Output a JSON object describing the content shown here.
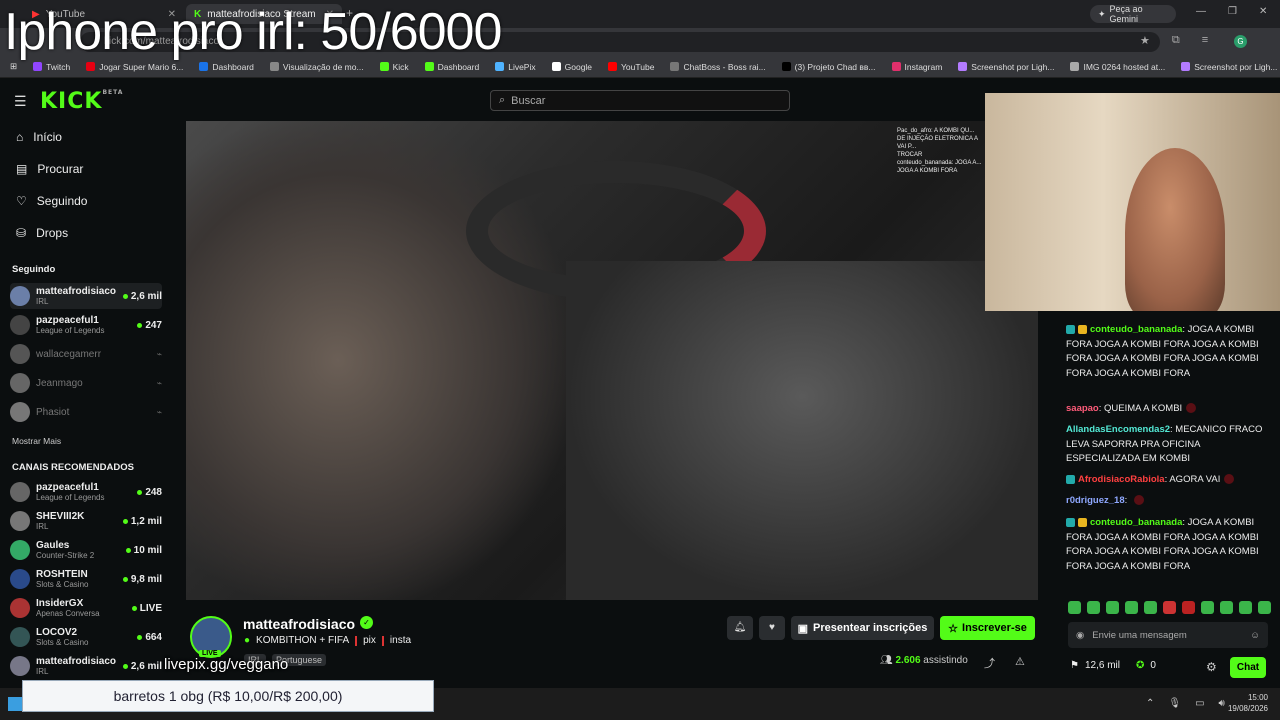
{
  "overlay_title": "Iphone pro irl: 50/6000",
  "browser": {
    "tabs": [
      {
        "label": "YouTube"
      },
      {
        "label": "matteafrodisiaco Stream"
      }
    ],
    "gemini_label": "Peça ao Gemini",
    "url": "kick.com/matteafrodisiaco",
    "bookmarks": [
      "Twitch",
      "Jogar Super Mario 6...",
      "Dashboard",
      "Visualização de mo...",
      "Kick",
      "Dashboard",
      "LivePix",
      "Google",
      "YouTube",
      "ChatBoss - Boss rai...",
      "(3) Projeto Chad вв...",
      "Instagram",
      "Screenshot por Ligh...",
      "IMG 0264 hosted at...",
      "Screenshot por Ligh..."
    ]
  },
  "kick": {
    "logo": "KICK",
    "logo_beta": "BETA",
    "search_placeholder": "Buscar",
    "nav": [
      {
        "label": "Início",
        "icon": "home-icon"
      },
      {
        "label": "Procurar",
        "icon": "browse-icon"
      },
      {
        "label": "Seguindo",
        "icon": "heart-icon"
      },
      {
        "label": "Drops",
        "icon": "drops-icon"
      }
    ],
    "following_header": "Seguindo",
    "following": [
      {
        "name": "matteafrodisiaco",
        "category": "IRL",
        "viewers": "2,6 mil",
        "online": true
      },
      {
        "name": "pazpeaceful1",
        "category": "League of Legends",
        "viewers": "247",
        "online": true
      },
      {
        "name": "wallacegamerr",
        "category": "",
        "viewers": "",
        "online": false
      },
      {
        "name": "Jeanmago",
        "category": "",
        "viewers": "",
        "online": false
      },
      {
        "name": "Phasiot",
        "category": "",
        "viewers": "",
        "online": false
      }
    ],
    "show_more": "Mostrar Mais",
    "recommended_header": "CANAIS RECOMENDADOS",
    "recommended": [
      {
        "name": "pazpeaceful1",
        "category": "League of Legends",
        "viewers": "248"
      },
      {
        "name": "SHEVIII2K",
        "category": "IRL",
        "viewers": "1,2 mil"
      },
      {
        "name": "Gaules",
        "category": "Counter-Strike 2",
        "viewers": "10 mil"
      },
      {
        "name": "ROSHTEIN",
        "category": "Slots & Casino",
        "viewers": "9,8 mil"
      },
      {
        "name": "InsiderGX",
        "category": "Apenas Conversa",
        "viewers": "LIVE"
      },
      {
        "name": "LOCOV2",
        "category": "Slots & Casino",
        "viewers": "664"
      },
      {
        "name": "matteafrodisiaco",
        "category": "IRL",
        "viewers": "2,6 mil"
      }
    ]
  },
  "stream": {
    "streamer": "matteafrodisiaco",
    "live_tag": "LIVE",
    "title": "KOMBITHON + FIFA",
    "links": [
      "pix",
      "insta"
    ],
    "tags": [
      "IRL",
      "Portuguese"
    ],
    "viewers": "2.606",
    "viewers_label": "assistindo",
    "gift_label": "Presentear inscrições",
    "subscribe_label": "Inscrever-se"
  },
  "video_overlay_chat": [
    "Pac_do_afro: A KOMBI QU...",
    "DE INJEÇÃO ELETRONICA A VAI P...",
    "TROCAR",
    "conteudo_bananada: JOGA A...",
    "JOGA A KOMBI FORA"
  ],
  "chat": {
    "messages": [
      {
        "user": "conteudo_bananada",
        "color": "#53fc18",
        "text": "JOGA A KOMBI FORA JOGA A KOMBI FORA JOGA A KOMBI FORA JOGA A KOMBI FORA JOGA A KOMBI FORA JOGA A KOMBI FORA"
      },
      {
        "user": "saapao",
        "color": "#ff5c7a",
        "text": "QUEIMA A KOMBI"
      },
      {
        "user": "AllandasEncomendas2",
        "color": "#53e8d4",
        "text": "MECANICO FRACO LEVA SAPORRA PRA OFICINA ESPECIALIZADA EM KOMBI"
      },
      {
        "user": "AfrodisiacoRabiola",
        "color": "#ff4040",
        "text": "AGORA VAI"
      },
      {
        "user": "r0driguez_18",
        "color": "#8fa8ff",
        "text": ""
      },
      {
        "user": "conteudo_bananada",
        "color": "#53fc18",
        "text": "JOGA A KOMBI FORA JOGA A KOMBI FORA JOGA A KOMBI FORA JOGA A KOMBI FORA JOGA A KOMBI FORA JOGA A KOMBI FORA"
      }
    ],
    "input_placeholder": "Envie uma mensagem",
    "kicks": "12,6 mil",
    "points": "0",
    "chat_button": "Chat"
  },
  "overlays": {
    "livepix": "livepix.gg/veggano",
    "donation_goal": "barretos 1 obg (R$ 10,00/R$ 200,00)"
  },
  "taskbar": {
    "time": "15:00",
    "date": "19/08/2026"
  }
}
